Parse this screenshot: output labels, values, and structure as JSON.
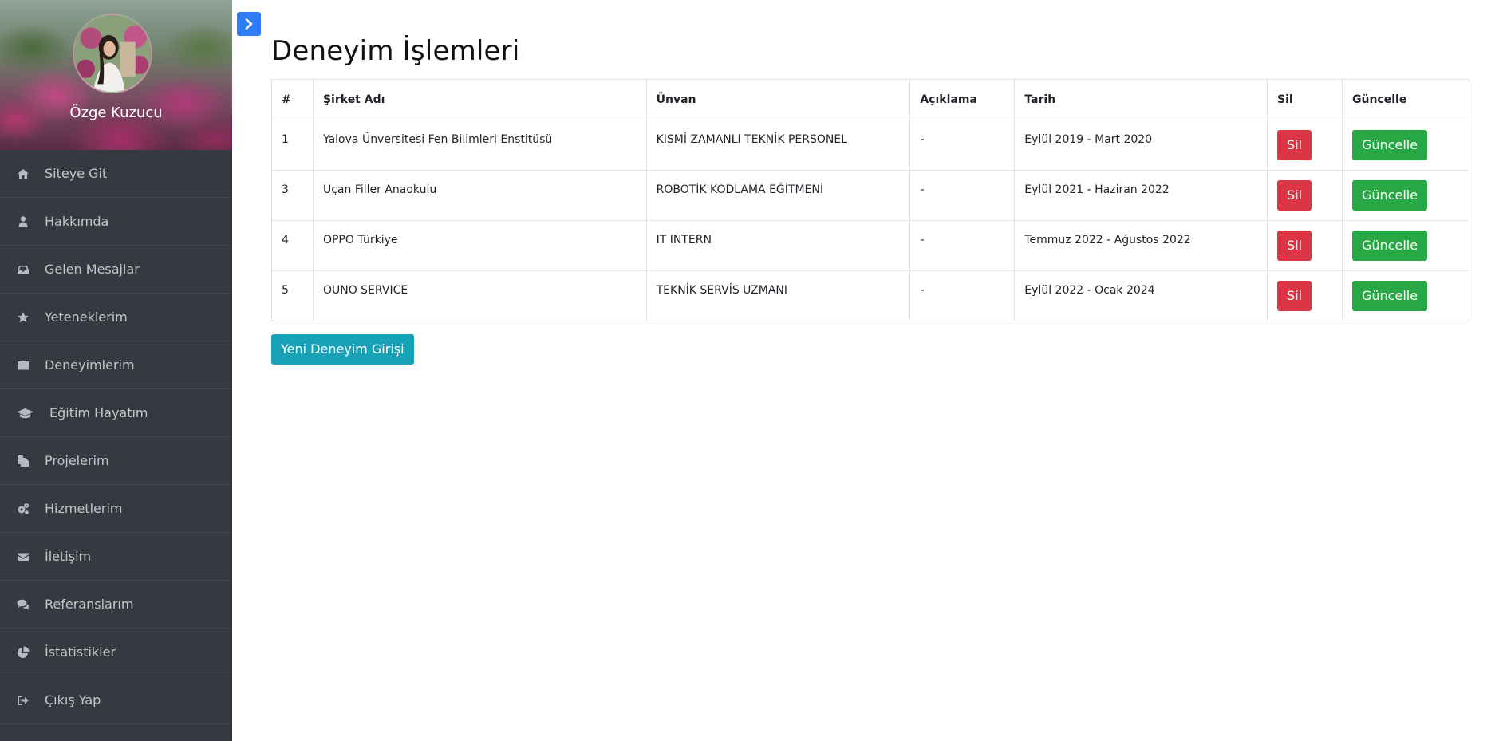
{
  "profile": {
    "name": "Özge Kuzucu"
  },
  "sidebar": {
    "items": [
      {
        "label": "Siteye Git",
        "icon": "home-icon"
      },
      {
        "label": "Hakkımda",
        "icon": "user-icon"
      },
      {
        "label": "Gelen Mesajlar",
        "icon": "inbox-icon"
      },
      {
        "label": "Yeteneklerim",
        "icon": "star-icon"
      },
      {
        "label": "Deneyimlerim",
        "icon": "briefcase-icon"
      },
      {
        "label": "Eğitim Hayatım",
        "icon": "graduation-cap-icon"
      },
      {
        "label": "Projelerim",
        "icon": "files-icon"
      },
      {
        "label": "Hizmetlerim",
        "icon": "cogs-icon"
      },
      {
        "label": "İletişim",
        "icon": "envelope-icon"
      },
      {
        "label": "Referanslarım",
        "icon": "comments-icon"
      },
      {
        "label": "İstatistikler",
        "icon": "pie-chart-icon"
      },
      {
        "label": "Çıkış Yap",
        "icon": "sign-out-icon"
      }
    ]
  },
  "toggle": {
    "icon": "chevron-right-icon"
  },
  "page": {
    "title": "Deneyim İşlemleri"
  },
  "table": {
    "headers": {
      "num": "#",
      "company": "Şirket Adı",
      "title": "Ünvan",
      "description": "Açıklama",
      "date": "Tarih",
      "delete": "Sil",
      "update": "Güncelle"
    },
    "rows": [
      {
        "id": "1",
        "company": "Yalova Ünversitesi Fen Bilimleri Enstitüsü",
        "title": "KISMİ ZAMANLI TEKNİK PERSONEL",
        "description": "-",
        "date": "Eylül 2019 - Mart 2020",
        "delete_label": "Sil",
        "update_label": "Güncelle"
      },
      {
        "id": "3",
        "company": "Uçan Filler Anaokulu",
        "title": "ROBOTİK KODLAMA EĞİTMENİ",
        "description": "-",
        "date": "Eylül 2021 - Haziran 2022",
        "delete_label": "Sil",
        "update_label": "Güncelle"
      },
      {
        "id": "4",
        "company": "OPPO Türkiye",
        "title": "IT INTERN",
        "description": "-",
        "date": "Temmuz 2022 - Ağustos 2022",
        "delete_label": "Sil",
        "update_label": "Güncelle"
      },
      {
        "id": "5",
        "company": "OUNO SERVICE",
        "title": "TEKNİK SERVİS UZMANI",
        "description": "-",
        "date": "Eylül 2022 - Ocak 2024",
        "delete_label": "Sil",
        "update_label": "Güncelle"
      }
    ]
  },
  "actions": {
    "new_label": "Yeni Deneyim Girişi"
  },
  "colors": {
    "sidebar_bg": "#343a40",
    "danger": "#dc3545",
    "success": "#28a745",
    "info": "#17a2b8",
    "primary": "#2e7cf6"
  }
}
